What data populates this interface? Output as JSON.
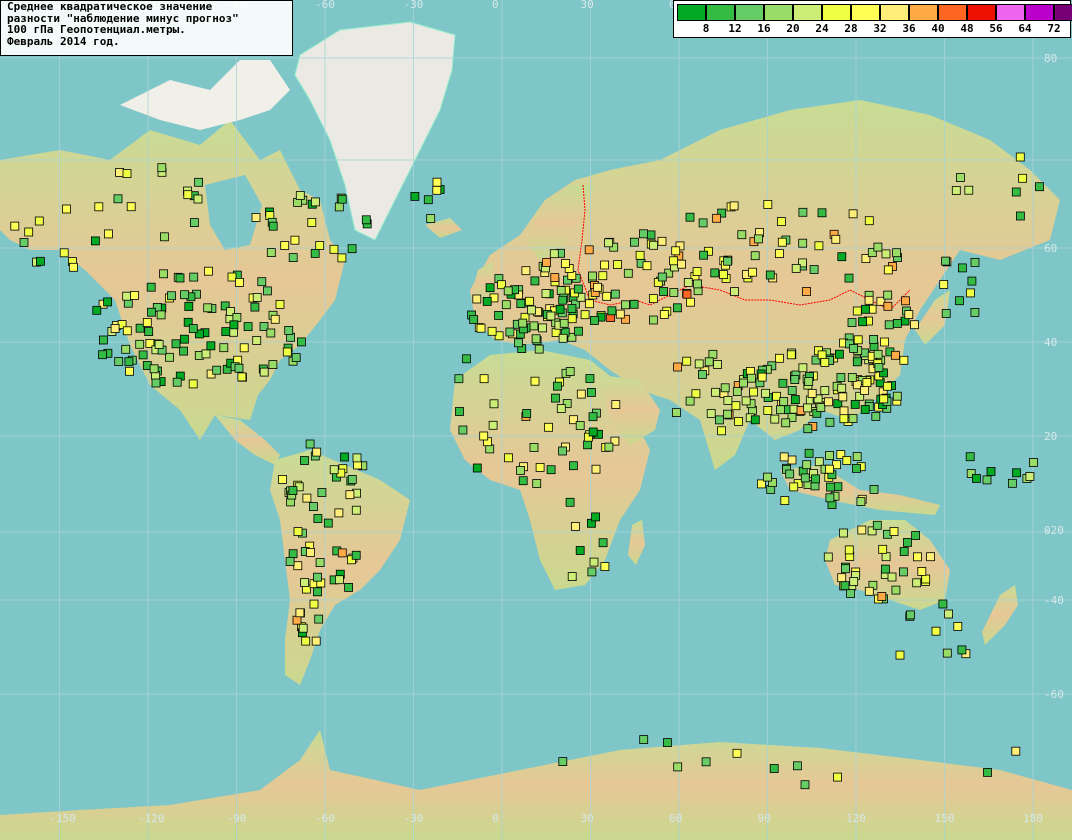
{
  "title": {
    "lines": [
      "Среднее квадратическое значение",
      "разности \"наблюдение минус прогноз\"",
      "100 гПа Геопотенциал.метры.",
      "Февраль 2014 год."
    ]
  },
  "legend": {
    "labels": [
      "8",
      "12",
      "16",
      "20",
      "24",
      "28",
      "32",
      "36",
      "40",
      "48",
      "56",
      "64",
      "72"
    ],
    "colors": [
      "#00aa22",
      "#33bb44",
      "#66cc66",
      "#99dd66",
      "#ccee77",
      "#eeff44",
      "#ffff55",
      "#ffee77",
      "#ffaa44",
      "#ff6622",
      "#ee1100",
      "#ee66ee",
      "#bb00cc",
      "#770077"
    ]
  },
  "map": {
    "longitude_ticks": [
      "-150",
      "-120",
      "-90",
      "-60",
      "-30",
      "0",
      "30",
      "60",
      "90",
      "120",
      "150",
      "180"
    ],
    "latitude_ticks": [
      "80",
      "60",
      "40",
      "20",
      "0",
      "-20",
      "-40",
      "-60"
    ],
    "colors": {
      "ocean": "#7fc6c8",
      "land": "#e8c89a",
      "land_green": "#b9d98c",
      "ice": "#f4f4f2",
      "grid": "#a9d3d6",
      "border": "#ff0000",
      "station_outline": "#000000"
    }
  }
}
